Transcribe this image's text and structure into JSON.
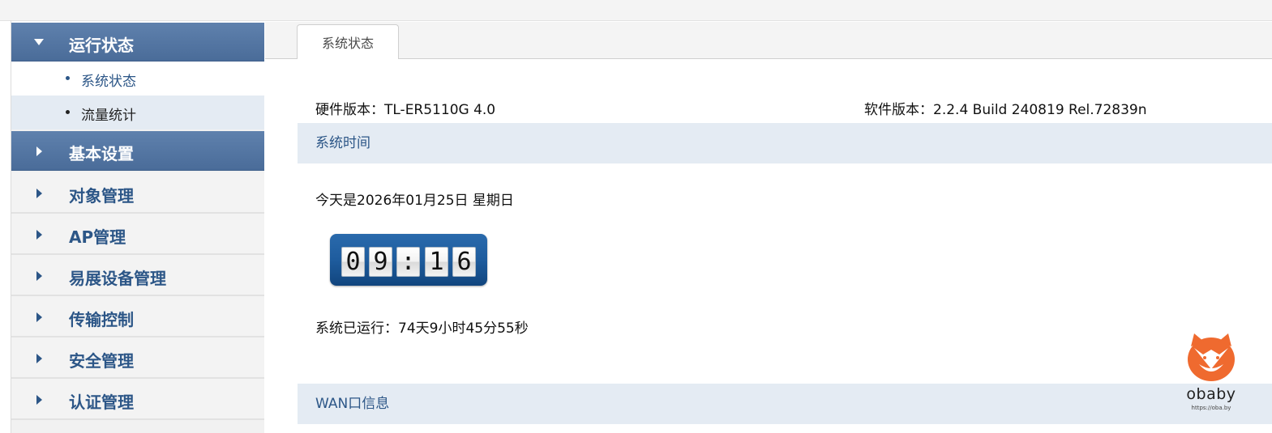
{
  "sidebar": {
    "groups": [
      {
        "label": "运行状态",
        "icon": "caret-down-icon",
        "expanded": true,
        "subitems": [
          {
            "label": "系统状态",
            "selected": true
          },
          {
            "label": "流量统计",
            "selected": false
          }
        ]
      },
      {
        "label": "基本设置",
        "icon": "caret-right-icon",
        "expanded": false
      },
      {
        "label": "对象管理",
        "icon": "caret-right-icon",
        "expanded": false
      },
      {
        "label": "AP管理",
        "icon": "caret-right-icon",
        "expanded": false
      },
      {
        "label": "易展设备管理",
        "icon": "caret-right-icon",
        "expanded": false
      },
      {
        "label": "传输控制",
        "icon": "caret-right-icon",
        "expanded": false
      },
      {
        "label": "安全管理",
        "icon": "caret-right-icon",
        "expanded": false
      },
      {
        "label": "认证管理",
        "icon": "caret-right-icon",
        "expanded": false
      }
    ]
  },
  "main": {
    "tab": "系统状态",
    "hardware": "硬件版本：TL-ER5110G 4.0",
    "software": "软件版本：2.2.4 Build 240819 Rel.72839n",
    "sections": {
      "system_time": "系统时间",
      "wan": "WAN口信息"
    },
    "date_text": "今天是2026年01月25日 星期日",
    "clock": {
      "h1": "0",
      "h2": "9",
      "sep": ":",
      "m1": "1",
      "m2": "6"
    },
    "uptime": "系统已运行：74天9小时45分55秒"
  },
  "watermark": {
    "name": "obaby",
    "url": "https://oba.by",
    "icon": "fox-logo-icon"
  },
  "colors": {
    "menu_active_bg": "#5477a4",
    "menu_text": "#2c5687",
    "section_bg": "#e4ebf3",
    "clock_bg": "#1e5c9e",
    "logo_orange": "#ef6a2f"
  }
}
